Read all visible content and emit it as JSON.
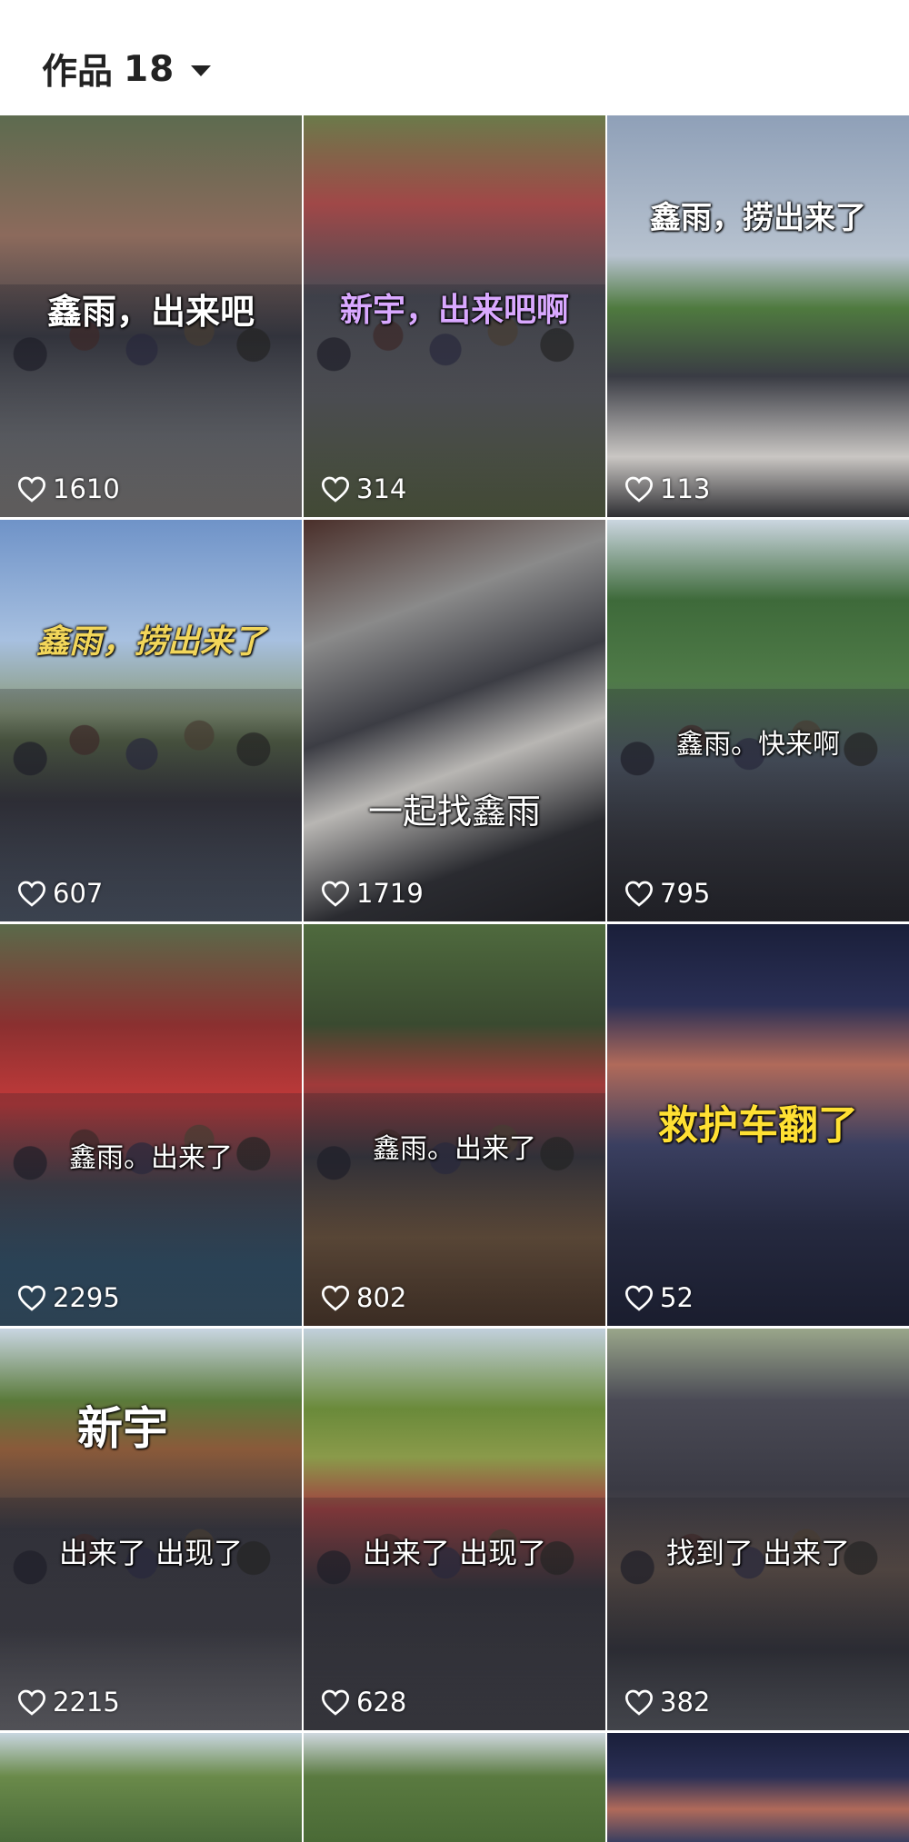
{
  "header": {
    "label": "作品",
    "count": "18"
  },
  "tiles": [
    {
      "caption": "鑫雨，出来吧",
      "likes": "1610"
    },
    {
      "caption": "新宇，出来吧啊",
      "likes": "314"
    },
    {
      "caption": "鑫雨，捞出来了",
      "likes": "113"
    },
    {
      "caption": "鑫雨，捞出来了",
      "likes": "607"
    },
    {
      "caption": "一起找鑫雨",
      "likes": "1719"
    },
    {
      "caption": "鑫雨。快来啊",
      "likes": "795"
    },
    {
      "caption": "鑫雨。出来了",
      "likes": "2295"
    },
    {
      "caption": "鑫雨。出来了",
      "likes": "802"
    },
    {
      "caption": "救护车翻了",
      "likes": "52"
    },
    {
      "caption": "新宇",
      "caption2": "出来了  出现了",
      "likes": "2215"
    },
    {
      "caption": "出来了  出现了",
      "likes": "628"
    },
    {
      "caption": "找到了  出来了",
      "likes": "382"
    }
  ],
  "icons": {
    "like": "heart-outline-icon",
    "dropdown": "caret-down-icon"
  }
}
